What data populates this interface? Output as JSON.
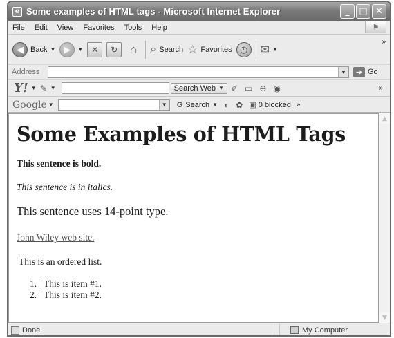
{
  "window": {
    "title": "Some examples of HTML tags - Microsoft Internet Explorer",
    "buttons": [
      "_",
      "□",
      "✕"
    ]
  },
  "menu": [
    "File",
    "Edit",
    "View",
    "Favorites",
    "Tools",
    "Help"
  ],
  "toolbar": {
    "back_label": "Back",
    "search_label": "Search",
    "favorites_label": "Favorites"
  },
  "address": {
    "label": "Address",
    "value": "",
    "go_label": "Go"
  },
  "yahoo": {
    "logo": "Y!",
    "search_value": "",
    "search_web_label": "Search Web"
  },
  "google": {
    "logo": "Google",
    "search_value": "",
    "search_label": "Search",
    "blocked_label": "0 blocked"
  },
  "page": {
    "heading": "Some Examples of HTML Tags",
    "bold_sentence": "This sentence is bold.",
    "italic_sentence": "This sentence is in italics.",
    "type14_sentence": "This sentence uses 14-point type.",
    "link_text": "John Wiley web site.",
    "ordered_intro": "This is an ordered list.",
    "list_items": [
      {
        "num": "1.",
        "text": "This is item #1."
      },
      {
        "num": "2.",
        "text": "This is item #2."
      }
    ]
  },
  "status": {
    "left": "Done",
    "zone": "My Computer"
  },
  "colors": {
    "titlebar": "#7a7a7a",
    "link": "#555555"
  }
}
